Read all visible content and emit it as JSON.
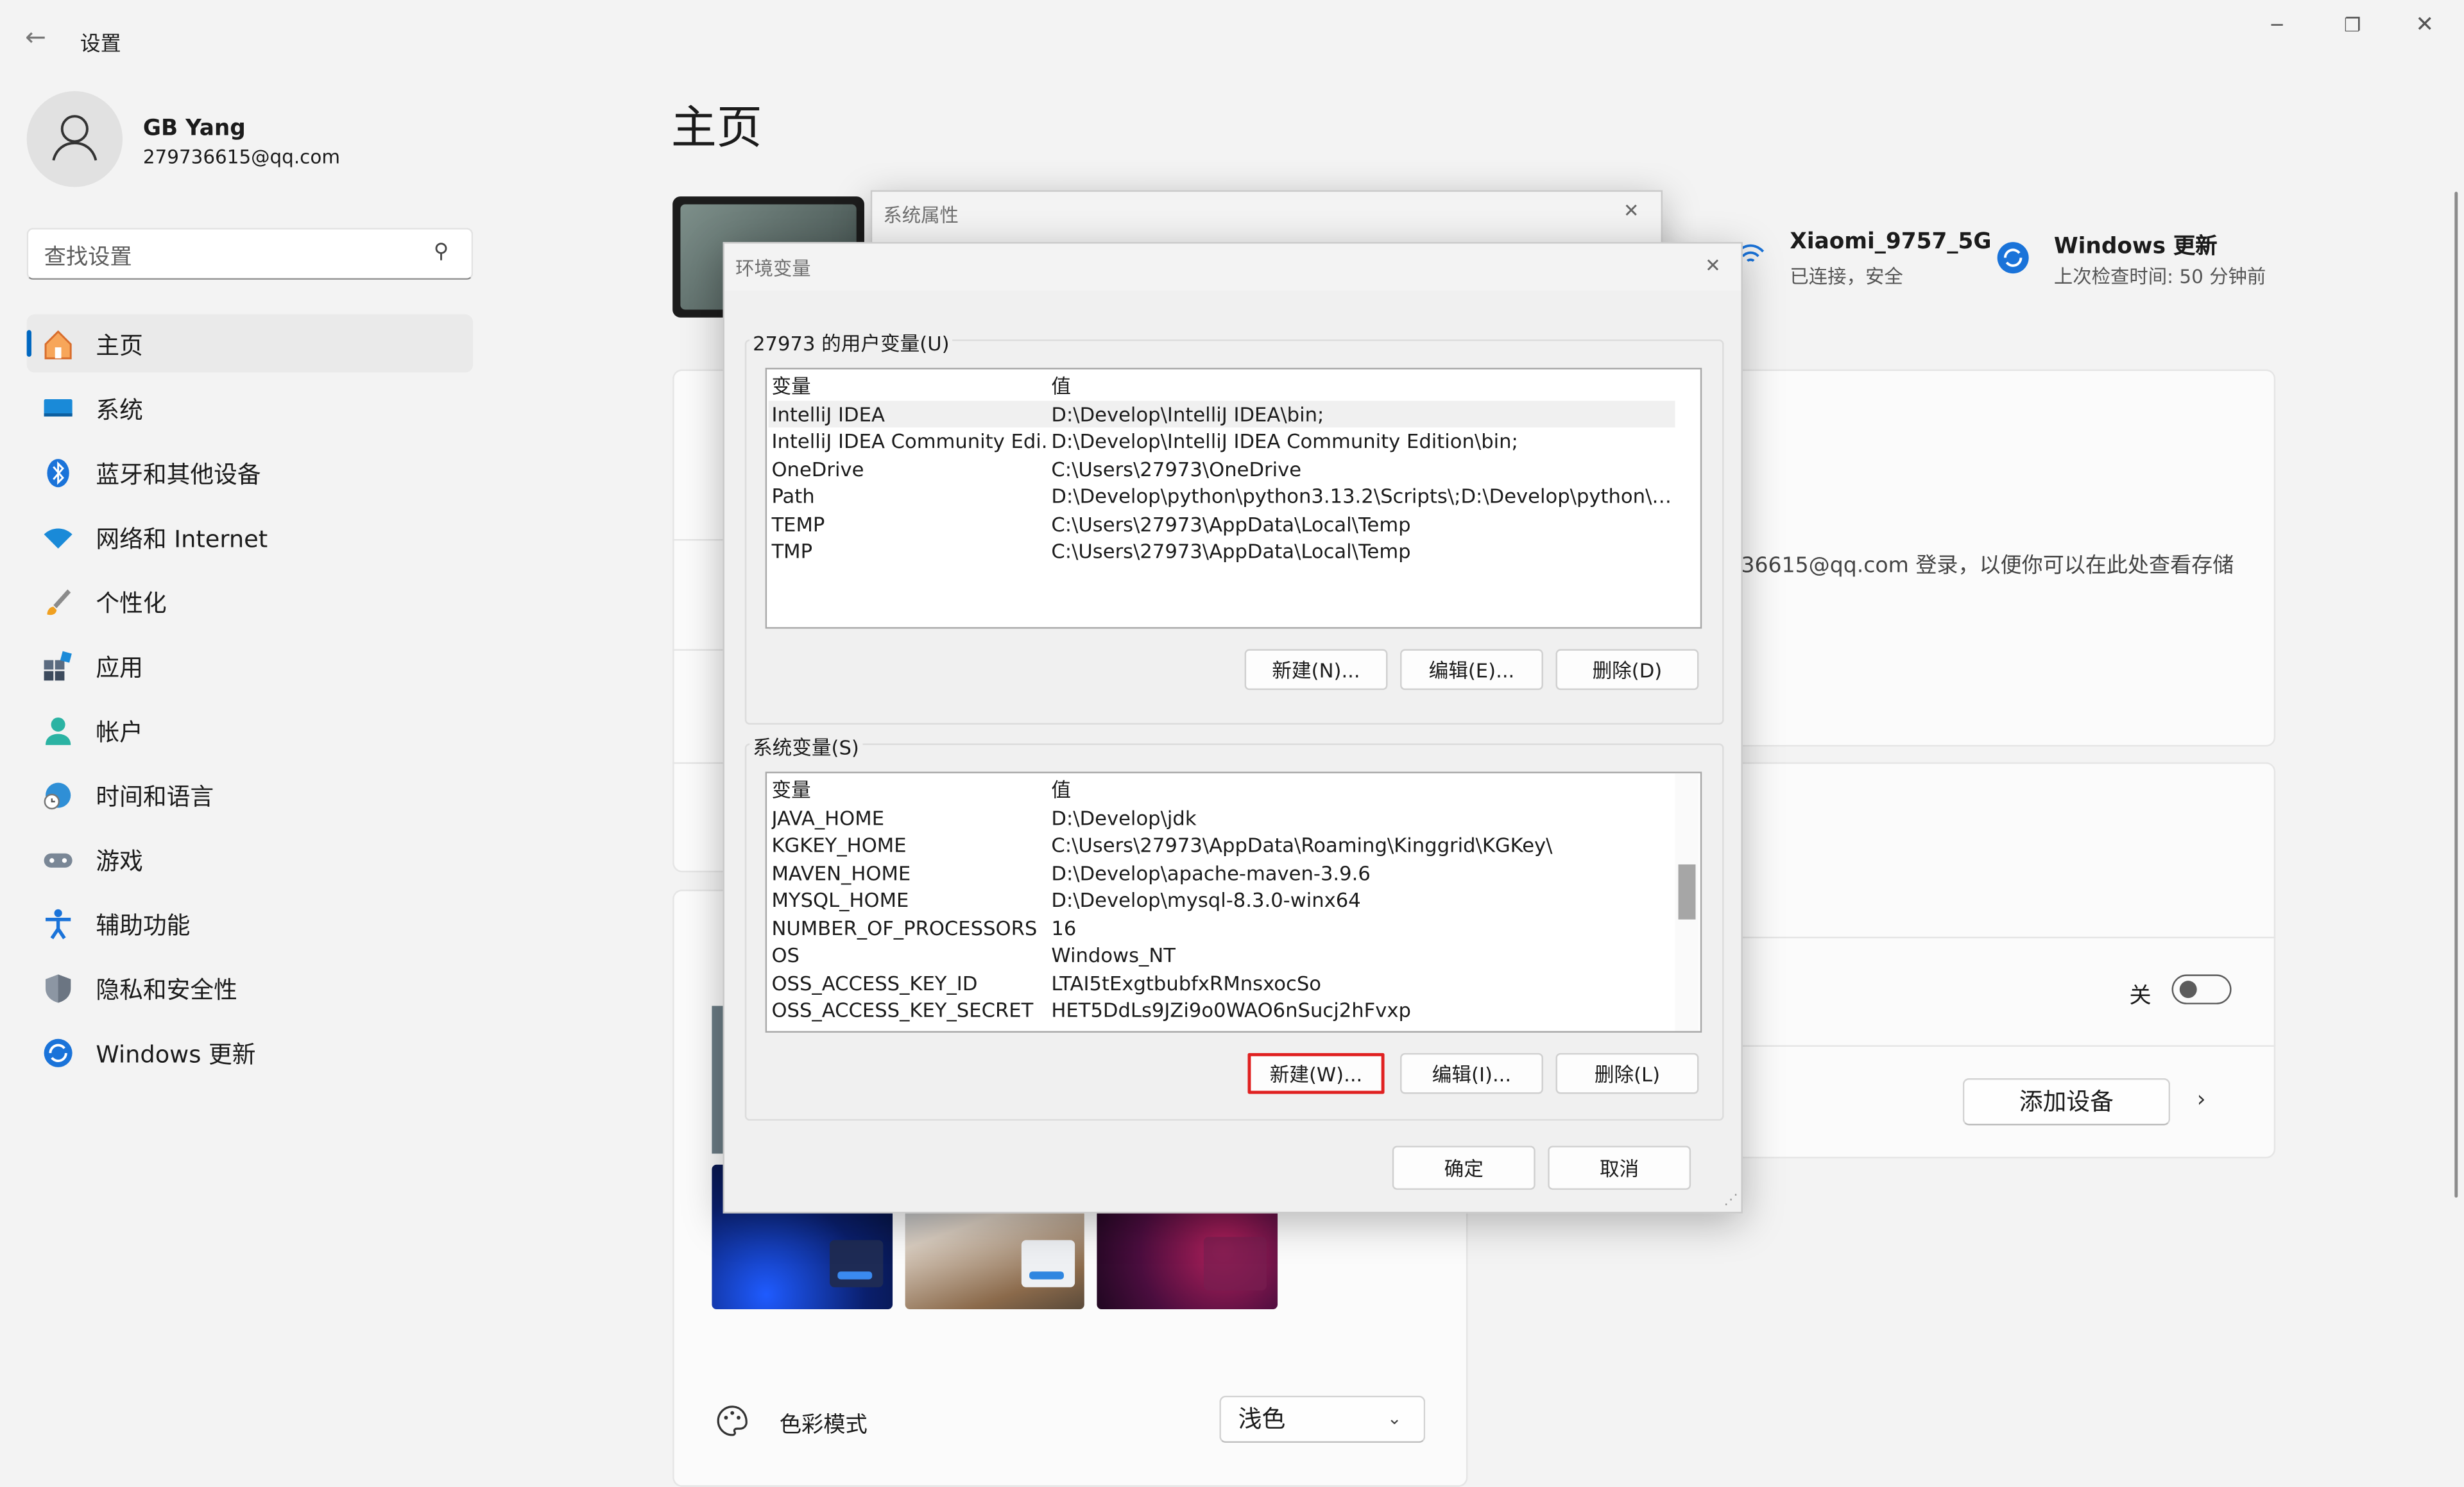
{
  "window": {
    "title": "设置"
  },
  "user": {
    "name": "GB Yang",
    "email": "279736615@qq.com"
  },
  "search": {
    "placeholder": "查找设置"
  },
  "sidebar": {
    "items": [
      {
        "label": "主页"
      },
      {
        "label": "系统"
      },
      {
        "label": "蓝牙和其他设备"
      },
      {
        "label": "网络和 Internet"
      },
      {
        "label": "个性化"
      },
      {
        "label": "应用"
      },
      {
        "label": "帐户"
      },
      {
        "label": "时间和语言"
      },
      {
        "label": "游戏"
      },
      {
        "label": "辅助功能"
      },
      {
        "label": "隐私和安全性"
      },
      {
        "label": "Windows 更新"
      }
    ]
  },
  "main": {
    "title": "主页",
    "wifi": {
      "name": "Xiaomi_9757_5G",
      "status": "已连接，安全"
    },
    "update": {
      "title": "Windows 更新",
      "status": "上次检查时间: 50 分钟前"
    },
    "storage_text": "36615@qq.com 登录，以便你可以在此处查看存储",
    "toggle_label": "关",
    "add_device_label": "添加设备",
    "color_mode": {
      "label": "色彩模式",
      "value": "浅色"
    }
  },
  "sysprops": {
    "title": "系统属性"
  },
  "envdlg": {
    "title": "环境变量",
    "user_group_label": "27973 的用户变量(U)",
    "sys_group_label": "系统变量(S)",
    "header": {
      "name": "变量",
      "value": "值"
    },
    "user_vars": [
      {
        "name": "IntelliJ IDEA",
        "value": "D:\\Develop\\IntelliJ IDEA\\bin;"
      },
      {
        "name": "IntelliJ IDEA Community Edi...",
        "value": "D:\\Develop\\IntelliJ IDEA Community Edition\\bin;"
      },
      {
        "name": "OneDrive",
        "value": "C:\\Users\\27973\\OneDrive"
      },
      {
        "name": "Path",
        "value": "D:\\Develop\\python\\python3.13.2\\Scripts\\;D:\\Develop\\python\\pyt..."
      },
      {
        "name": "TEMP",
        "value": "C:\\Users\\27973\\AppData\\Local\\Temp"
      },
      {
        "name": "TMP",
        "value": "C:\\Users\\27973\\AppData\\Local\\Temp"
      }
    ],
    "sys_vars": [
      {
        "name": "JAVA_HOME",
        "value": "D:\\Develop\\jdk"
      },
      {
        "name": "KGKEY_HOME",
        "value": "C:\\Users\\27973\\AppData\\Roaming\\Kinggrid\\KGKey\\"
      },
      {
        "name": "MAVEN_HOME",
        "value": "D:\\Develop\\apache-maven-3.9.6"
      },
      {
        "name": "MYSQL_HOME",
        "value": "D:\\Develop\\mysql-8.3.0-winx64"
      },
      {
        "name": "NUMBER_OF_PROCESSORS",
        "value": "16"
      },
      {
        "name": "OS",
        "value": "Windows_NT"
      },
      {
        "name": "OSS_ACCESS_KEY_ID",
        "value": "LTAI5tExgtbubfxRMnsxocSo"
      },
      {
        "name": "OSS_ACCESS_KEY_SECRET",
        "value": "HET5DdLs9JZi9o0WAO6nSucj2hFvxp"
      }
    ],
    "user_buttons": {
      "new": "新建(N)...",
      "edit": "编辑(E)...",
      "delete": "删除(D)"
    },
    "sys_buttons": {
      "new": "新建(W)...",
      "edit": "编辑(I)...",
      "delete": "删除(L)"
    },
    "ok": "确定",
    "cancel": "取消"
  },
  "colors": {
    "accent": "#0067c0",
    "highlight_border": "#e02020"
  }
}
